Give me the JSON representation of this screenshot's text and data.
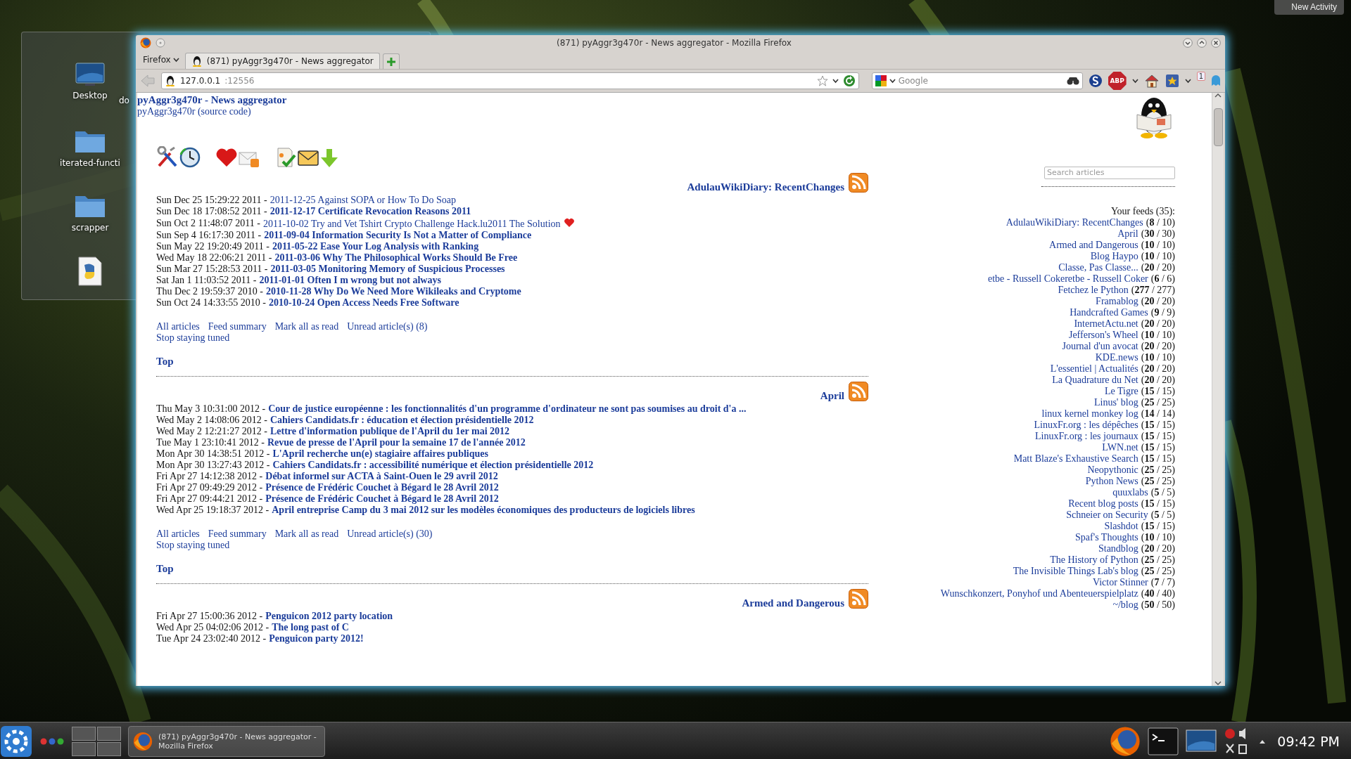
{
  "desktop": {
    "new_activity": "New Activity",
    "folder_view": {
      "items": [
        {
          "label": "Desktop",
          "kind": "monitor"
        },
        {
          "label": "iterated-functi",
          "kind": "folder"
        },
        {
          "label": "scrapper",
          "kind": "folder"
        },
        {
          "kind": "python"
        }
      ],
      "cut_label": "do"
    }
  },
  "browser": {
    "title": "(871) pyAggr3g470r - News aggregator - Mozilla Firefox",
    "menu_button": "Firefox",
    "tabs": [
      {
        "label": "(871) pyAggr3g470r - News aggregator",
        "selected": true
      }
    ],
    "url_host": "127.0.0.1",
    "url_port": ":12556",
    "search_placeholder": "Google",
    "abp_label": "ABP",
    "counter_badge": "1"
  },
  "page": {
    "title": "pyAggr3g470r - News aggregator",
    "subtitle": "pyAggr3g470r (source code)",
    "feeds": [
      {
        "title": "AdulauWikiDiary: RecentChanges",
        "articles": [
          {
            "date": "Sun Dec 25 15:29:22 2011 -",
            "title": "2011-12-25 Against SOPA or How To Do Soap",
            "read": true,
            "liked": false
          },
          {
            "date": "Sun Dec 18 17:08:52 2011 -",
            "title": "2011-12-17 Certificate Revocation Reasons 2011",
            "read": false,
            "liked": false
          },
          {
            "date": "Sun Oct 2 11:48:07 2011 -",
            "title": "2011-10-02 Try and Vet Tshirt Crypto Challenge Hack.lu2011 The Solution",
            "read": true,
            "liked": true
          },
          {
            "date": "Sun Sep 4 16:17:30 2011 -",
            "title": "2011-09-04 Information Security Is Not a Matter of Compliance",
            "read": false,
            "liked": false
          },
          {
            "date": "Sun May 22 19:20:49 2011 -",
            "title": "2011-05-22 Ease Your Log Analysis with Ranking",
            "read": false,
            "liked": false
          },
          {
            "date": "Wed May 18 22:06:21 2011 -",
            "title": "2011-03-06 Why The Philosophical Works Should Be Free",
            "read": false,
            "liked": false
          },
          {
            "date": "Sun Mar 27 15:28:53 2011 -",
            "title": "2011-03-05 Monitoring Memory of Suspicious Processes",
            "read": false,
            "liked": false
          },
          {
            "date": "Sat Jan 1 11:03:52 2011 -",
            "title": "2011-01-01 Often I m wrong but not always",
            "read": false,
            "liked": false
          },
          {
            "date": "Thu Dec 2 19:59:37 2010 -",
            "title": "2010-11-28 Why Do We Need More Wikileaks and Cryptome",
            "read": false,
            "liked": false
          },
          {
            "date": "Sun Oct 24 14:33:55 2010 -",
            "title": "2010-10-24 Open Access Needs Free Software",
            "read": false,
            "liked": false
          }
        ],
        "links": [
          "All articles",
          "Feed summary",
          "Mark all as read",
          "Unread article(s) (8)"
        ],
        "stop": "Stop staying tuned",
        "top": "Top"
      },
      {
        "title": "April",
        "articles": [
          {
            "date": "Thu May 3 10:31:00 2012 -",
            "title": "Cour de justice européenne : les fonctionnalités d'un programme d'ordinateur ne sont pas soumises au droit d'a ...",
            "read": false,
            "liked": false
          },
          {
            "date": "Wed May 2 14:08:06 2012 -",
            "title": "Cahiers Candidats.fr : éducation et élection présidentielle 2012",
            "read": false,
            "liked": false
          },
          {
            "date": "Wed May 2 12:21:27 2012 -",
            "title": "Lettre d'information publique de l'April du 1er mai 2012",
            "read": false,
            "liked": false
          },
          {
            "date": "Tue May 1 23:10:41 2012 -",
            "title": "Revue de presse de l'April pour la semaine 17 de l'année 2012",
            "read": false,
            "liked": false
          },
          {
            "date": "Mon Apr 30 14:38:51 2012 -",
            "title": "L'April recherche un(e) stagiaire affaires publiques",
            "read": false,
            "liked": false
          },
          {
            "date": "Mon Apr 30 13:27:43 2012 -",
            "title": "Cahiers Candidats.fr : accessibilité numérique et élection présidentielle 2012",
            "read": false,
            "liked": false
          },
          {
            "date": "Fri Apr 27 14:12:38 2012 -",
            "title": "Débat informel sur ACTA à Saint-Ouen le 29 avril 2012",
            "read": false,
            "liked": false
          },
          {
            "date": "Fri Apr 27 09:49:29 2012 -",
            "title": "Présence de Frédéric Couchet à Bégard le 28 Avril 2012",
            "read": false,
            "liked": false
          },
          {
            "date": "Fri Apr 27 09:44:21 2012 -",
            "title": "Présence de Frédéric Couchet à Bégard le 28 Avril 2012",
            "read": false,
            "liked": false
          },
          {
            "date": "Wed Apr 25 19:18:37 2012 -",
            "title": "April entreprise Camp du 3 mai 2012 sur les modèles économiques des producteurs de logiciels libres",
            "read": false,
            "liked": false
          }
        ],
        "links": [
          "All articles",
          "Feed summary",
          "Mark all as read",
          "Unread article(s) (30)"
        ],
        "stop": "Stop staying tuned",
        "top": "Top"
      },
      {
        "title": "Armed and Dangerous",
        "articles": [
          {
            "date": "Fri Apr 27 15:00:36 2012 -",
            "title": "Penguicon 2012 party location",
            "read": false,
            "liked": false
          },
          {
            "date": "Wed Apr 25 04:02:06 2012 -",
            "title": "The long past of C",
            "read": false,
            "liked": false
          },
          {
            "date": "Tue Apr 24 23:02:40 2012 -",
            "title": "Penguicon party 2012!",
            "read": false,
            "liked": false
          }
        ]
      }
    ],
    "sidebar": {
      "search_placeholder": "Search articles",
      "heading": "Your feeds (35):",
      "items": [
        {
          "name": "AdulauWikiDiary: RecentChanges",
          "count": "(**8** / 10)"
        },
        {
          "name": "April",
          "count": "(**30** / 30)"
        },
        {
          "name": "Armed and Dangerous",
          "count": "(**10** / 10)"
        },
        {
          "name": "Blog Haypo",
          "count": "(**10** / 10)"
        },
        {
          "name": "Classe, Pas Classe...",
          "count": "(**20** / 20)"
        },
        {
          "name": "etbe - Russell Cokeretbe - Russell Coker",
          "count": "(**6** / 6)"
        },
        {
          "name": "Fetchez le Python",
          "count": "(**277** / 277)"
        },
        {
          "name": "Framablog",
          "count": "(**20** / 20)"
        },
        {
          "name": "Handcrafted Games",
          "count": "(**9** / 9)"
        },
        {
          "name": "InternetActu.net",
          "count": "(**20** / 20)"
        },
        {
          "name": "Jefferson's Wheel",
          "count": "(**10** / 10)"
        },
        {
          "name": "Journal d'un avocat",
          "count": "(**20** / 20)"
        },
        {
          "name": "KDE.news",
          "count": "(**10** / 10)"
        },
        {
          "name": "L'essentiel | Actualités",
          "count": "(**20** / 20)"
        },
        {
          "name": "La Quadrature du Net",
          "count": "(**20** / 20)"
        },
        {
          "name": "Le Tigre",
          "count": "(**15** / 15)"
        },
        {
          "name": "Linus' blog",
          "count": "(**25** / 25)"
        },
        {
          "name": "linux kernel monkey log",
          "count": "(**14** / 14)"
        },
        {
          "name": "LinuxFr.org : les dépêches",
          "count": "(**15** / 15)"
        },
        {
          "name": "LinuxFr.org : les journaux",
          "count": "(**15** / 15)"
        },
        {
          "name": "LWN.net",
          "count": "(**15** / 15)"
        },
        {
          "name": "Matt Blaze's Exhaustive Search",
          "count": "(**15** / 15)"
        },
        {
          "name": "Neopythonic",
          "count": "(**25** / 25)"
        },
        {
          "name": "Python News",
          "count": "(**25** / 25)"
        },
        {
          "name": "quuxlabs",
          "count": "(**5** / 5)"
        },
        {
          "name": "Recent blog posts",
          "count": "(**15** / 15)"
        },
        {
          "name": "Schneier on Security",
          "count": "(**5** / 5)"
        },
        {
          "name": "Slashdot",
          "count": "(**15** / 15)"
        },
        {
          "name": "Spaf's Thoughts",
          "count": "(**10** / 10)"
        },
        {
          "name": "Standblog",
          "count": "(**20** / 20)"
        },
        {
          "name": "The History of Python",
          "count": "(**25** / 25)"
        },
        {
          "name": "The Invisible Things Lab's blog",
          "count": "(**25** / 25)"
        },
        {
          "name": "Victor Stinner",
          "count": "(**7** / 7)"
        },
        {
          "name": "Wunschkonzert, Ponyhof und Abenteuerspielplatz",
          "count": "(**40** / 40)"
        },
        {
          "name": "~/blog",
          "count": "(**50** / 50)"
        }
      ]
    }
  },
  "taskbar": {
    "task": "(871) pyAggr3g470r - News aggregator - Mozilla Firefox",
    "clock": "09:42 PM"
  }
}
